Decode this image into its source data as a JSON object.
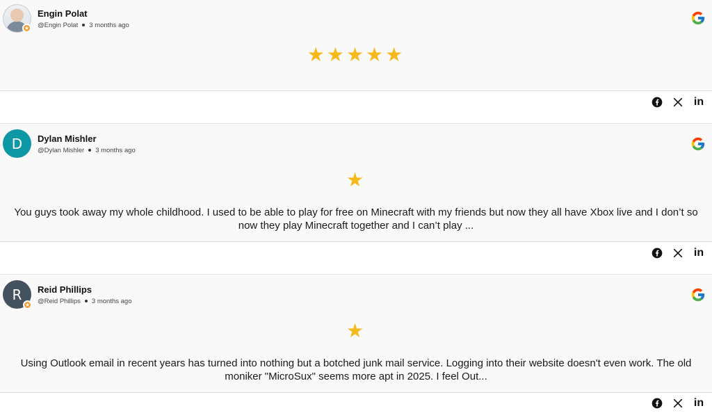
{
  "reviews": [
    {
      "author": "Engin Polat",
      "handle": "@Engin Polat",
      "time": "3 months ago",
      "avatar_type": "photo",
      "avatar_letter": "",
      "avatar_color": "#cccccc",
      "stars": "★★★★★",
      "rating": 5,
      "text": "",
      "source_icon": "google-icon"
    },
    {
      "author": "Dylan Mishler",
      "handle": "@Dylan Mishler",
      "time": "3 months ago",
      "avatar_type": "letter",
      "avatar_letter": "D",
      "avatar_color": "#0e97a5",
      "stars": "★",
      "rating": 1,
      "text": "You guys took away my whole childhood. I used to be able to play for free on Minecraft with my friends but now they all have Xbox live and I don’t so now they play Minecraft together and I can’t play ...",
      "source_icon": "google-icon"
    },
    {
      "author": "Reid Phillips",
      "handle": "@Reid Phillips",
      "time": "3 months ago",
      "avatar_type": "letter",
      "avatar_letter": "R",
      "avatar_color": "#44515e",
      "stars": "★",
      "rating": 1,
      "text": "Using Outlook email in recent years has turned into nothing but a botched junk mail service. Logging into their website doesn't even work. The old moniker \"MicroSux\" seems more apt in 2025. I feel Out...",
      "source_icon": "google-icon"
    }
  ],
  "share": {
    "icons": [
      "facebook-icon",
      "x-icon",
      "linkedin-icon"
    ],
    "linkedin_glyph": "in"
  },
  "colors": {
    "star": "#f6b91c",
    "card_bg": "#f9f9f9"
  }
}
